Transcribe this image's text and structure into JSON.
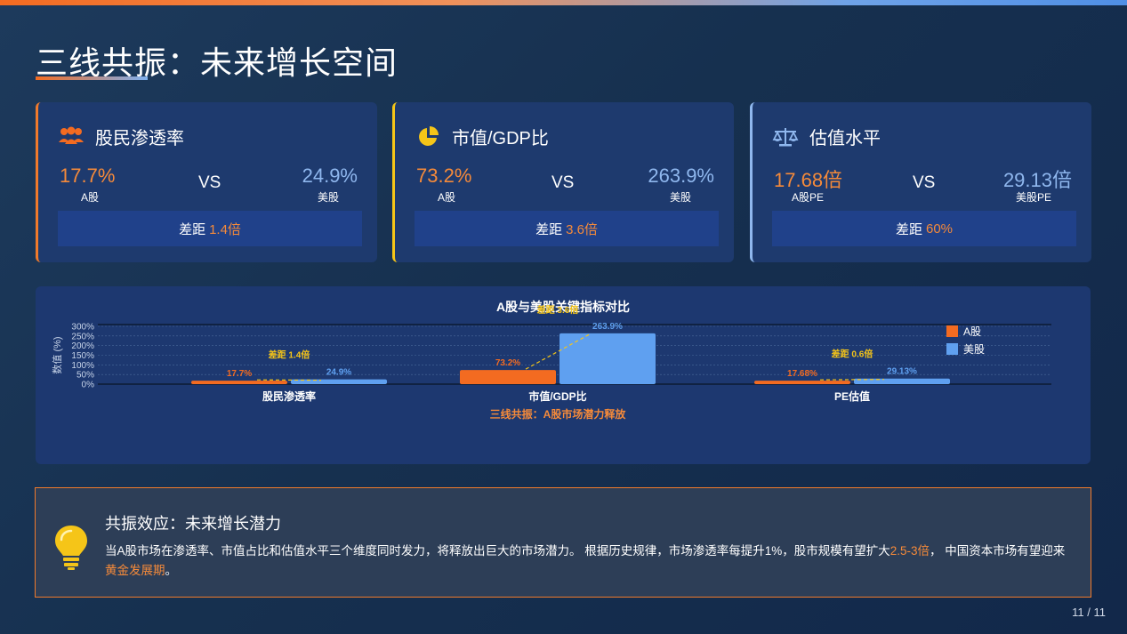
{
  "title": "三线共振：未来增长空间",
  "cards": [
    {
      "icon": "users-icon",
      "title": "股民渗透率",
      "a_value": "17.7%",
      "a_label": "A股",
      "vs": "VS",
      "b_value": "24.9%",
      "b_label": "美股",
      "gap_prefix": "差距",
      "gap_value": "1.4倍",
      "accent": "#f07a2b"
    },
    {
      "icon": "pie-chart-icon",
      "title": "市值/GDP比",
      "a_value": "73.2%",
      "a_label": "A股",
      "vs": "VS",
      "b_value": "263.9%",
      "b_label": "美股",
      "gap_prefix": "差距",
      "gap_value": "3.6倍",
      "accent": "#f5c518"
    },
    {
      "icon": "balance-scale-icon",
      "title": "估值水平",
      "a_value": "17.68倍",
      "a_label": "A股PE",
      "vs": "VS",
      "b_value": "29.13倍",
      "b_label": "美股PE",
      "gap_prefix": "差距",
      "gap_value": "60%",
      "accent": "#8fb7ee"
    }
  ],
  "chart_data": {
    "type": "bar",
    "title": "A股与美股关键指标对比",
    "ylabel": "数值 (%)",
    "ylim": [
      0,
      300
    ],
    "yticks": [
      "0%",
      "50%",
      "100%",
      "150%",
      "200%",
      "250%",
      "300%"
    ],
    "categories": [
      "股民渗透率",
      "市值/GDP比",
      "PE估值"
    ],
    "series": [
      {
        "name": "A股",
        "values": [
          17.7,
          73.2,
          17.68
        ],
        "labels": [
          "17.7%",
          "73.2%",
          "17.68%"
        ],
        "color": "#f36b21"
      },
      {
        "name": "美股",
        "values": [
          24.9,
          263.9,
          29.13
        ],
        "labels": [
          "24.9%",
          "263.9%",
          "29.13%"
        ],
        "color": "#5fa0f0"
      }
    ],
    "gap_labels": [
      "差距 1.4倍",
      "差距 3.6倍",
      "差距 0.6倍"
    ],
    "footer": "三线共振：A股市场潜力释放",
    "legend_position": "top-right"
  },
  "insight": {
    "title": "共振效应：未来增长潜力",
    "text_1": "当A股市场在渗透率、市值占比和估值水平三个维度同时发力，将释放出巨大的市场潜力。 根据历史规律，市场渗透率每提升1%，股市规模有望扩大",
    "text_hl_1": "2.5-3倍",
    "text_2": "， 中国资本市场有望迎来",
    "text_hl_2": "黄金发展期",
    "text_3": "。"
  },
  "page": "11 / 11",
  "colors": {
    "orange": "#f36b21",
    "blue": "#5fa0f0",
    "yellow": "#f5c518"
  }
}
